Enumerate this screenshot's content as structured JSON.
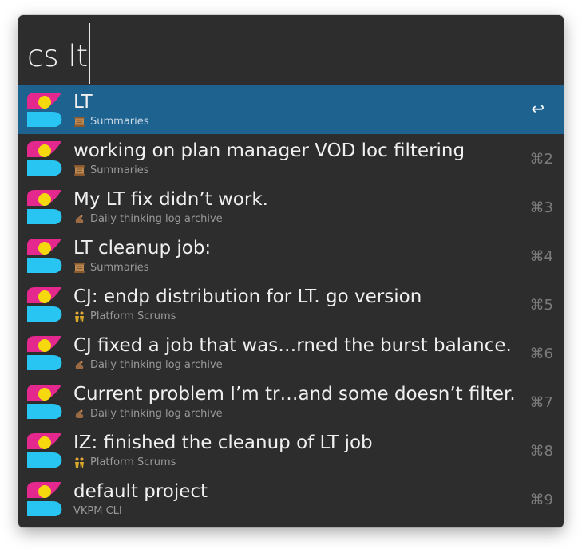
{
  "search": {
    "query": "cs lt"
  },
  "colors": {
    "window_bg": "#2d2d2d",
    "selected_bg": "#1e6390",
    "icon_magenta": "#e4288e",
    "icon_cyan": "#28c5f2",
    "icon_yellow": "#f5d90e"
  },
  "results": [
    {
      "title": "LT",
      "subtitle": "Summaries",
      "sub_icon": "scroll-icon",
      "shortcut": "↩",
      "selected": true
    },
    {
      "title": "working on plan manager VOD loc filtering",
      "subtitle": "Summaries",
      "sub_icon": "scroll-icon",
      "shortcut": "⌘2"
    },
    {
      "title": "My LT fix didn’t work.",
      "subtitle": "Daily thinking log archive",
      "sub_icon": "thinking-hand-icon",
      "shortcut": "⌘3"
    },
    {
      "title": "LT cleanup job:",
      "subtitle": "Summaries",
      "sub_icon": "scroll-icon",
      "shortcut": "⌘4"
    },
    {
      "title": "CJ: endp distribution for LT. go version",
      "subtitle": "Platform Scrums",
      "sub_icon": "people-icon",
      "shortcut": "⌘5"
    },
    {
      "title": "CJ fixed a job that was…rned the burst balance.",
      "subtitle": "Daily thinking log archive",
      "sub_icon": "thinking-hand-icon",
      "shortcut": "⌘6"
    },
    {
      "title": "Current problem I’m tr…and some doesn’t filter.",
      "subtitle": "Daily thinking log archive",
      "sub_icon": "thinking-hand-icon",
      "shortcut": "⌘7"
    },
    {
      "title": "IZ: finished the cleanup of LT job",
      "subtitle": "Platform Scrums",
      "sub_icon": "people-icon",
      "shortcut": "⌘8"
    },
    {
      "title": "default project",
      "subtitle": "VKPM CLI",
      "sub_icon": "",
      "shortcut": "⌘9"
    }
  ]
}
